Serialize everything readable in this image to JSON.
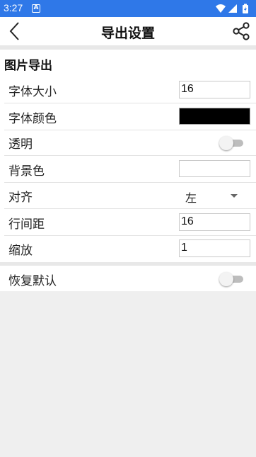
{
  "status_bar": {
    "time": "3:27",
    "a_icon": "A",
    "icons": [
      "wifi-icon",
      "signal-icon",
      "battery-icon"
    ]
  },
  "header": {
    "title": "导出设置",
    "back_icon": "chevron-left-icon",
    "share_icon": "share-icon"
  },
  "section": {
    "title": "图片导出"
  },
  "settings": {
    "font_size": {
      "label": "字体大小",
      "value": "16"
    },
    "font_color": {
      "label": "字体颜色",
      "color": "#000000"
    },
    "transparent": {
      "label": "透明",
      "on": false
    },
    "background_color": {
      "label": "背景色",
      "color": "#ffffff"
    },
    "align": {
      "label": "对齐",
      "value": "左"
    },
    "line_spacing": {
      "label": "行间距",
      "value": "16"
    },
    "scale": {
      "label": "缩放",
      "value": "1"
    }
  },
  "reset": {
    "label": "恢复默认",
    "on": false
  },
  "colors": {
    "status_bar": "#2f78e8",
    "background": "#efefef",
    "card": "#ffffff"
  }
}
